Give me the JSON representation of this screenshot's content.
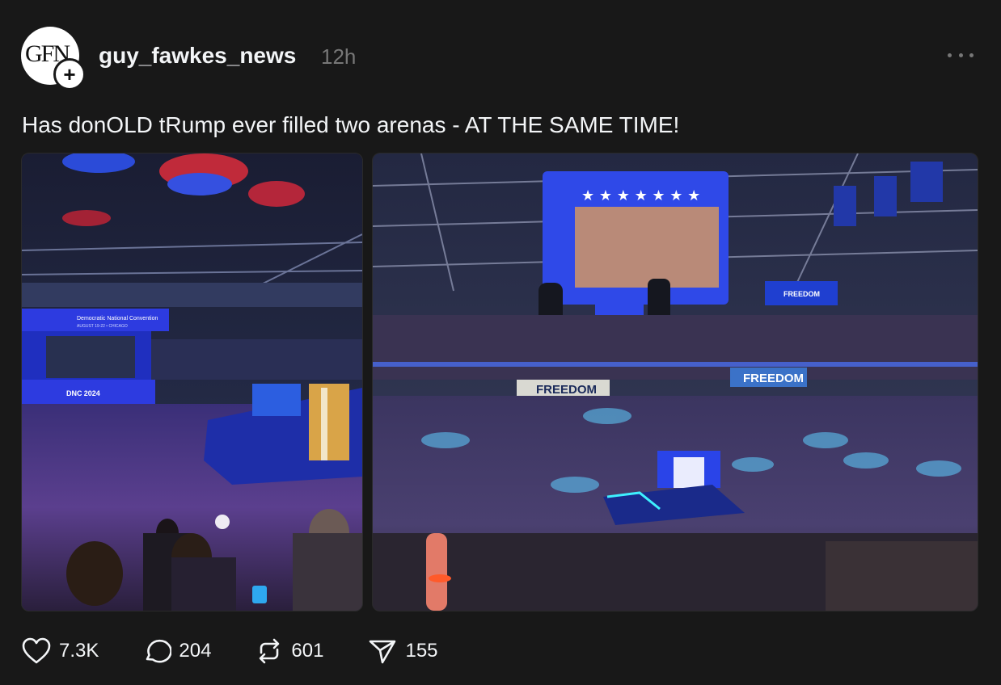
{
  "post": {
    "author": {
      "username": "guy_fawkes_news",
      "avatar_text": "GFN",
      "follow_icon": "plus-icon"
    },
    "timestamp": "12h",
    "text": "Has donOLD tRump ever filled two arenas - AT THE SAME TIME!",
    "media": [
      {
        "name": "convention-photo-left",
        "signs": {
          "title": "Democratic National Convention",
          "dates": "AUGUST 19-22 • CHICAGO",
          "logo": "DNC 2024"
        }
      },
      {
        "name": "arena-photo-right",
        "signs": {
          "banner_center": "FREEDOM",
          "banner_right": "FREEDOM",
          "banner_top": "FREEDOM"
        }
      }
    ],
    "actions": {
      "likes": {
        "icon": "heart-icon",
        "count": "7.3K"
      },
      "comments": {
        "icon": "comment-icon",
        "count": "204"
      },
      "reposts": {
        "icon": "repost-icon",
        "count": "601"
      },
      "shares": {
        "icon": "send-icon",
        "count": "155"
      }
    }
  },
  "colors": {
    "background": "#181818",
    "text": "#f3f5f7",
    "muted": "#777777",
    "stage_blue": "#2a3fd6"
  }
}
